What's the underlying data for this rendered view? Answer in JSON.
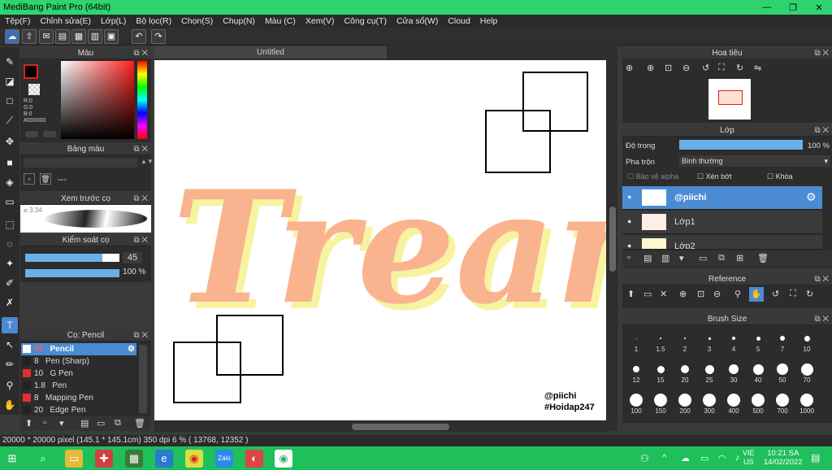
{
  "window": {
    "title": "MediBang Paint Pro (64bit)",
    "minimize": "—",
    "maximize": "❐",
    "close": "✕"
  },
  "menu": [
    "Tệp(F)",
    "Chỉnh sửa(E)",
    "Lớp(L)",
    "Bộ lọc(R)",
    "Chọn(S)",
    "Chụp(N)",
    "Màu (C)",
    "Xem(V)",
    "Công cụ(T)",
    "Cửa sổ(W)",
    "Cloud",
    "Help"
  ],
  "panels": {
    "color": {
      "title": "Màu",
      "rgb": [
        "R:0",
        "G:0",
        "B:0"
      ],
      "hex": "#000000"
    },
    "palette": {
      "title": "Bảng màu",
      "extra": "---"
    },
    "preview": {
      "title": "Xem trước cọ",
      "size": "3.34"
    },
    "brushcontrol": {
      "title": "Kiểm soát cọ",
      "size": "45",
      "opacity": "100 %",
      "size_fraction": 0.82,
      "opacity_fraction": 1.0
    },
    "brushlist": {
      "title": "Cọ: Pencil",
      "items": [
        {
          "size": "45",
          "name": "Pencil",
          "color": "#ff4b4b",
          "selected": true
        },
        {
          "size": "8",
          "name": "Pen (Sharp)",
          "color": "#222222",
          "selected": false
        },
        {
          "size": "10",
          "name": "G Pen",
          "color": "#e03030",
          "selected": false
        },
        {
          "size": "1.8",
          "name": "Pen",
          "color": "#222222",
          "selected": false
        },
        {
          "size": "8",
          "name": "Mapping Pen",
          "color": "#e03030",
          "selected": false
        },
        {
          "size": "20",
          "name": "Edge Pen",
          "color": "#222222",
          "selected": false
        }
      ]
    }
  },
  "canvas": {
    "tab": "Untitled",
    "art_text": "Treand",
    "watermark1": "@piichi",
    "watermark2": "#Hoidap247",
    "art_color": "#f9b48f"
  },
  "right": {
    "navigator": {
      "title": "Hoa tiêu"
    },
    "layer": {
      "title": "Lớp",
      "opacity_label": "Độ trong",
      "opacity_value": "100 %",
      "blend_label": "Pha trộn",
      "blend_value": "Bình thường",
      "protect_label": "Bảo vệ alpha",
      "clip_label": "Xén bớt",
      "lock_label": "Khóa",
      "rows": [
        {
          "name": "@piichi",
          "selected": true
        },
        {
          "name": "Lớp1",
          "selected": false
        },
        {
          "name": "Lớp2",
          "selected": false
        }
      ]
    },
    "reference": {
      "title": "Reference"
    },
    "brushsize": {
      "title": "Brush Size",
      "sizes": [
        "1",
        "1.5",
        "2",
        "3",
        "4",
        "5",
        "7",
        "10",
        "12",
        "15",
        "20",
        "25",
        "30",
        "40",
        "50",
        "70",
        "100",
        "150",
        "200",
        "300",
        "400",
        "500",
        "700",
        "1000"
      ]
    }
  },
  "status": "20000 * 20000 pixel   (145.1 * 145.1cm)   350 dpi   6 %   ( 13768, 12352 )",
  "taskbar": {
    "lang1": "VIE",
    "lang2": "US",
    "time": "10:21 SA",
    "date": "14/02/2022"
  }
}
